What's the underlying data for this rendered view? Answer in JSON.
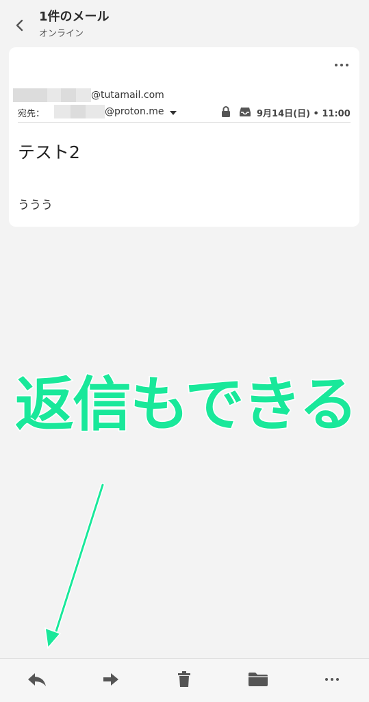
{
  "header": {
    "title": "1件のメール",
    "subtitle": "オンライン",
    "back_icon": "chevron-left-icon"
  },
  "mail": {
    "sender_email": "@tutamail.com",
    "to_label": "宛先：",
    "recipient_email": "@proton.me",
    "date": "9月14日(日) • 11:00",
    "subject": "テスト2",
    "body": "ううう",
    "icons": [
      "more-horizontal-icon",
      "chevron-down-icon",
      "lock-icon",
      "inbox-icon"
    ]
  },
  "annotation": {
    "text": "返信もできる",
    "color": "#19e89a"
  },
  "toolbar": {
    "icons": [
      "reply-icon",
      "forward-icon",
      "trash-icon",
      "folder-icon",
      "more-horizontal-icon"
    ]
  },
  "colors": {
    "background": "#f3f3f3",
    "card": "#ffffff",
    "accent": "#19e89a",
    "icon": "#555555"
  }
}
